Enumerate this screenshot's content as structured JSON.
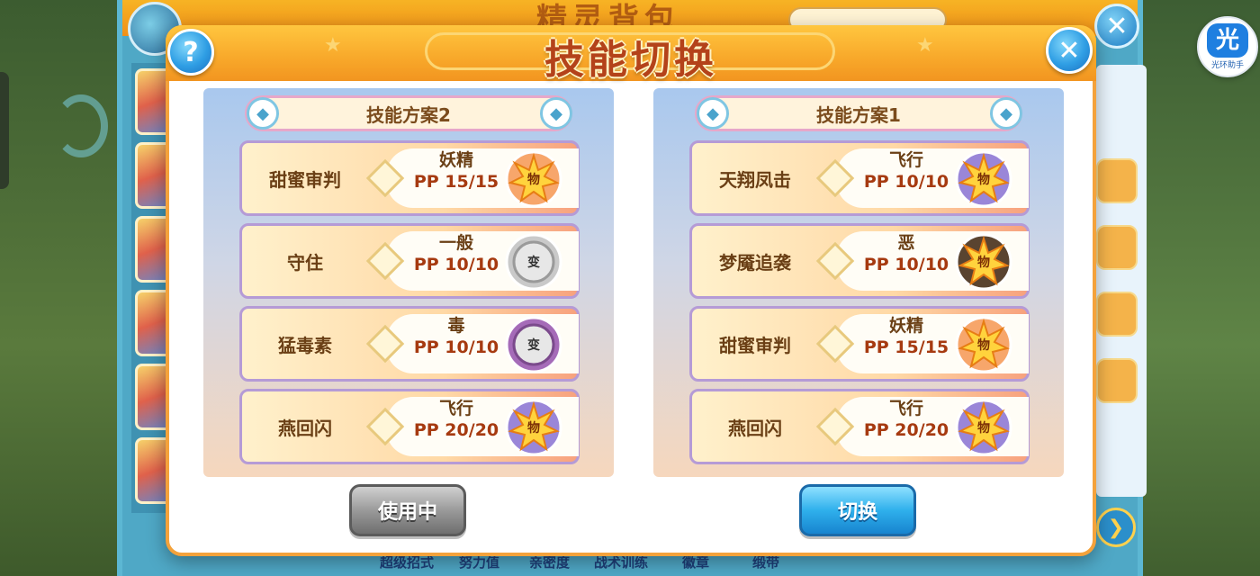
{
  "background": {
    "window_title": "精灵背包",
    "bottom_tabs": [
      "超级招式",
      "努力值",
      "亲密度",
      "战术训练",
      "徽章",
      "缎带"
    ]
  },
  "helper": {
    "glyph": "光",
    "label": "光环助手"
  },
  "modal": {
    "title": "技能切换",
    "help_glyph": "?",
    "close_glyph": "✕"
  },
  "plans": [
    {
      "title": "技能方案2",
      "skills": [
        {
          "name": "甜蜜审判",
          "type": "妖精",
          "pp": "PP 15/15",
          "category": "物",
          "badge_color": "#f7a66b"
        },
        {
          "name": "守住",
          "type": "一般",
          "pp": "PP 10/10",
          "category": "变",
          "badge_color": "#c9c9c9"
        },
        {
          "name": "猛毒素",
          "type": "毒",
          "pp": "PP 10/10",
          "category": "变",
          "badge_color": "#a56bb8"
        },
        {
          "name": "燕回闪",
          "type": "飞行",
          "pp": "PP 20/20",
          "category": "物",
          "badge_color": "#9a86d8"
        }
      ],
      "button": "使用中"
    },
    {
      "title": "技能方案1",
      "skills": [
        {
          "name": "天翔凤击",
          "type": "飞行",
          "pp": "PP 10/10",
          "category": "物",
          "badge_color": "#9a86d8"
        },
        {
          "name": "梦魇追袭",
          "type": "恶",
          "pp": "PP 10/10",
          "category": "物",
          "badge_color": "#5a4430"
        },
        {
          "name": "甜蜜审判",
          "type": "妖精",
          "pp": "PP 15/15",
          "category": "物",
          "badge_color": "#f7a66b"
        },
        {
          "name": "燕回闪",
          "type": "飞行",
          "pp": "PP 20/20",
          "category": "物",
          "badge_color": "#9a86d8"
        }
      ],
      "button": "切换"
    }
  ],
  "colors": {
    "accent_orange": "#f8a82a",
    "accent_blue": "#2fb0ec",
    "title_text": "#b4421a"
  }
}
